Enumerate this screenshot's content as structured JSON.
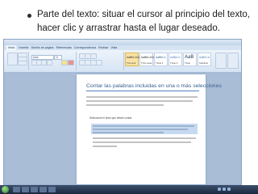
{
  "slide": {
    "bullet_text": "Parte del texto: situar el cursor al principio del texto, hacer clic y arrastrar hasta el lugar deseado."
  },
  "word_window": {
    "tabs": [
      "Inicio",
      "Insertar",
      "Diseño de página",
      "Referencias",
      "Correspondencia",
      "Revisar",
      "Vista"
    ],
    "font_name": "Arial",
    "font_size": "11",
    "styles": [
      {
        "sample": "AaBbCcDc",
        "name": "¶ Normal"
      },
      {
        "sample": "AaBbCcDc",
        "name": "¶ Sin espa..."
      },
      {
        "sample": "AaBbCc",
        "name": "Título 1"
      },
      {
        "sample": "AaBbCc",
        "name": "Título 2"
      },
      {
        "sample": "AaB",
        "name": "Título"
      },
      {
        "sample": "AaBbCcl",
        "name": "Subtítulo"
      }
    ],
    "document": {
      "title": "Contar las palabras incluidas en una o más selecciones",
      "bullet": "Seleccione el texto que desee contar."
    },
    "status": "Página: 1 de 1   Palabras: 72/1003"
  },
  "colors": {
    "accent": "#4f81bd",
    "heading": "#365f91",
    "selection": "#c6d9f0"
  }
}
